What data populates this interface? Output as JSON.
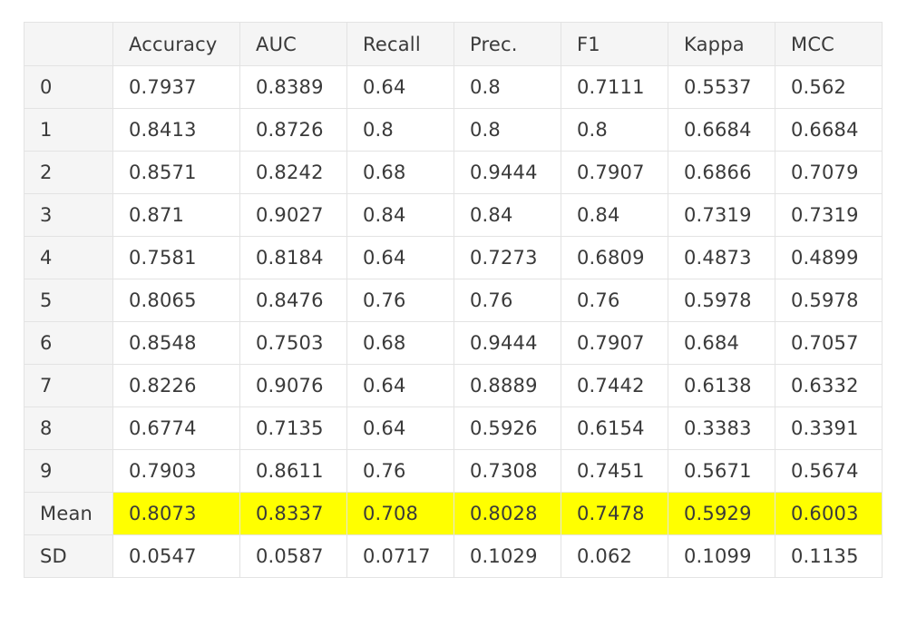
{
  "table": {
    "index_header": "",
    "columns": [
      "Accuracy",
      "AUC",
      "Recall",
      "Prec.",
      "F1",
      "Kappa",
      "MCC"
    ],
    "highlight_color": "#ffff00",
    "rows": [
      {
        "index": "0",
        "values": [
          "0.7937",
          "0.8389",
          "0.64",
          "0.8",
          "0.7111",
          "0.5537",
          "0.562"
        ]
      },
      {
        "index": "1",
        "values": [
          "0.8413",
          "0.8726",
          "0.8",
          "0.8",
          "0.8",
          "0.6684",
          "0.6684"
        ]
      },
      {
        "index": "2",
        "values": [
          "0.8571",
          "0.8242",
          "0.68",
          "0.9444",
          "0.7907",
          "0.6866",
          "0.7079"
        ]
      },
      {
        "index": "3",
        "values": [
          "0.871",
          "0.9027",
          "0.84",
          "0.84",
          "0.84",
          "0.7319",
          "0.7319"
        ]
      },
      {
        "index": "4",
        "values": [
          "0.7581",
          "0.8184",
          "0.64",
          "0.7273",
          "0.6809",
          "0.4873",
          "0.4899"
        ]
      },
      {
        "index": "5",
        "values": [
          "0.8065",
          "0.8476",
          "0.76",
          "0.76",
          "0.76",
          "0.5978",
          "0.5978"
        ]
      },
      {
        "index": "6",
        "values": [
          "0.8548",
          "0.7503",
          "0.68",
          "0.9444",
          "0.7907",
          "0.684",
          "0.7057"
        ]
      },
      {
        "index": "7",
        "values": [
          "0.8226",
          "0.9076",
          "0.64",
          "0.8889",
          "0.7442",
          "0.6138",
          "0.6332"
        ]
      },
      {
        "index": "8",
        "values": [
          "0.6774",
          "0.7135",
          "0.64",
          "0.5926",
          "0.6154",
          "0.3383",
          "0.3391"
        ]
      },
      {
        "index": "9",
        "values": [
          "0.7903",
          "0.8611",
          "0.76",
          "0.7308",
          "0.7451",
          "0.5671",
          "0.5674"
        ]
      },
      {
        "index": "Mean",
        "values": [
          "0.8073",
          "0.8337",
          "0.708",
          "0.8028",
          "0.7478",
          "0.5929",
          "0.6003"
        ]
      },
      {
        "index": "SD",
        "values": [
          "0.0547",
          "0.0587",
          "0.0717",
          "0.1029",
          "0.062",
          "0.1099",
          "0.1135"
        ]
      }
    ]
  }
}
